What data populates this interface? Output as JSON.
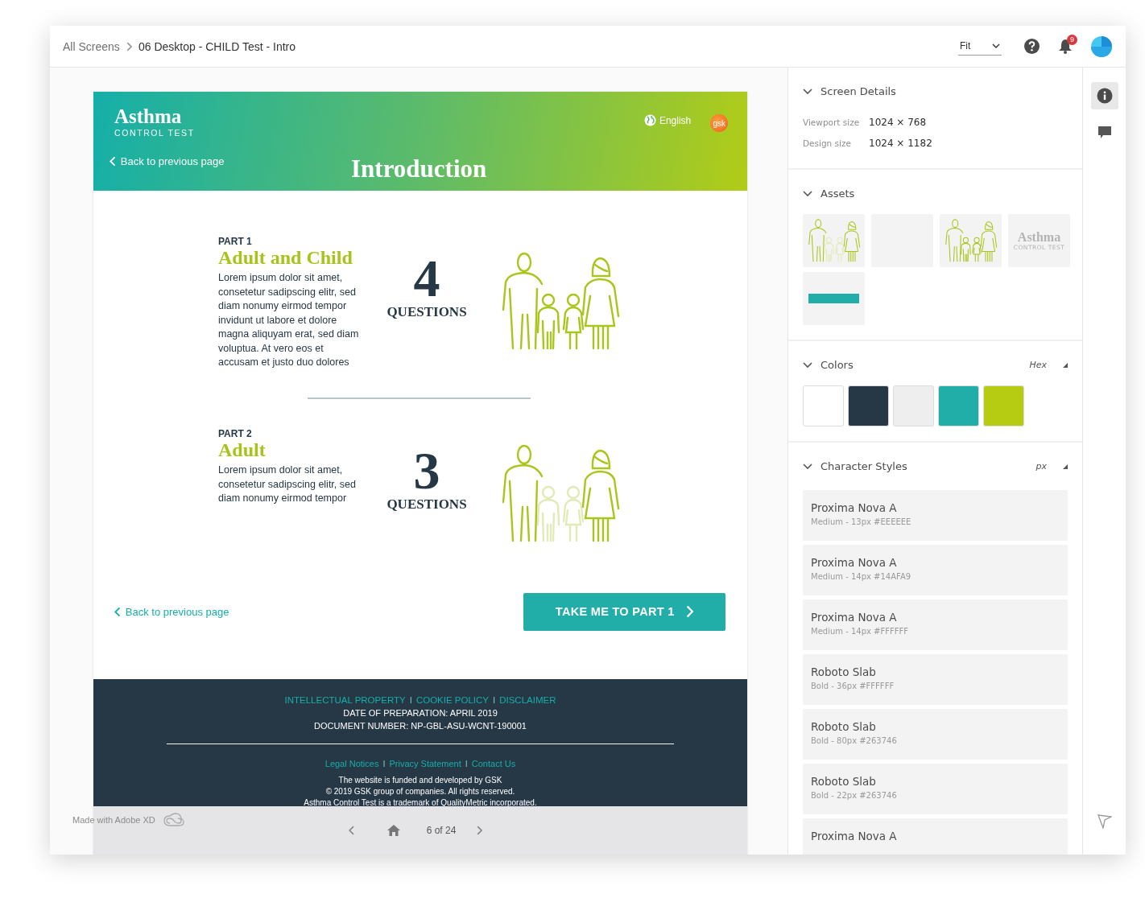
{
  "topbar": {
    "breadcrumb": [
      "All Screens",
      "06 Desktop - CHILD Test - Intro"
    ],
    "zoom": "Fit",
    "notifications": "9"
  },
  "artboard": {
    "logo": {
      "name": "Asthma",
      "tagline": "CONTROL TEST"
    },
    "language": "English",
    "brand": "gsk",
    "back_link": "Back to previous page",
    "title": "Introduction",
    "parts": [
      {
        "label": "PART 1",
        "title": "Adult and Child",
        "body": "Lorem ipsum dolor sit amet, consetetur sadipscing elitr, sed diam nonumy eirmod tempor invidunt ut labore et dolore magna aliquyam erat, sed diam voluptua. At vero eos et accusam et justo duo dolores",
        "count": "4",
        "count_label": "QUESTIONS",
        "children_faded": false
      },
      {
        "label": "PART 2",
        "title": "Adult",
        "body": "Lorem ipsum dolor sit amet, consetetur sadipscing elitr, sed diam nonumy eirmod tempor",
        "count": "3",
        "count_label": "QUESTIONS",
        "children_faded": true
      }
    ],
    "bottom_back_link": "Back to previous page",
    "cta": "TAKE ME TO PART 1",
    "footer": {
      "top_links": [
        {
          "kind": "link",
          "text": "INTELLECTUAL PROPERTY"
        },
        {
          "kind": "separator",
          "text": "I"
        },
        {
          "kind": "link",
          "text": "COOKIE POLICY"
        },
        {
          "kind": "separator",
          "text": "I"
        },
        {
          "kind": "link",
          "text": "DISCLAIMER"
        }
      ],
      "lines": [
        "DATE OF PREPARATION: APRIL 2019",
        "DOCUMENT NUMBER: NP-GBL-ASU-WCNT-190001"
      ],
      "bottom_links": [
        {
          "kind": "link",
          "text": "Legal Notices"
        },
        {
          "kind": "separator",
          "text": "I"
        },
        {
          "kind": "link",
          "text": "Privacy Statement"
        },
        {
          "kind": "separator",
          "text": "I"
        },
        {
          "kind": "link",
          "text": "Contact Us"
        }
      ],
      "notes": [
        "The website is funded and developed by GSK",
        "© 2019 GSK group of companies. All rights reserved.",
        "Asthma Control Test is a trademark of QualityMetric incorporated."
      ]
    }
  },
  "viewer": {
    "made_with": "Made with Adobe XD",
    "pager": "6 of 24"
  },
  "panel": {
    "screen_details": {
      "title": "Screen Details",
      "rows": [
        {
          "label": "Viewport size",
          "value": "1024 × 768"
        },
        {
          "label": "Design size",
          "value": "1024 × 1182"
        }
      ]
    },
    "assets": {
      "title": "Assets",
      "items": [
        {
          "kind": "family_faded"
        },
        {
          "kind": "blank"
        },
        {
          "kind": "family"
        },
        {
          "kind": "logo",
          "name": "Asthma",
          "tagline": "CONTROL TEST"
        },
        {
          "kind": "button"
        }
      ]
    },
    "colors": {
      "title": "Colors",
      "format": "Hex",
      "swatches": [
        {
          "color": "#ffffff"
        },
        {
          "color": "#263746"
        },
        {
          "color": "#eeeeee"
        },
        {
          "color": "#22aea8"
        },
        {
          "color": "#b5cc12"
        }
      ]
    },
    "character_styles": {
      "title": "Character Styles",
      "unit": "px",
      "items": [
        {
          "font": "Proxima Nova A",
          "detail": "Medium - 13px #EEEEEE"
        },
        {
          "font": "Proxima Nova A",
          "detail": "Medium - 14px #14AFA9"
        },
        {
          "font": "Proxima Nova A",
          "detail": "Medium - 14px #FFFFFF"
        },
        {
          "font": "Roboto Slab",
          "detail": "Bold - 36px #FFFFFF"
        },
        {
          "font": "Roboto Slab",
          "detail": "Bold - 80px #263746"
        },
        {
          "font": "Roboto Slab",
          "detail": "Bold - 22px #263746"
        },
        {
          "font": "Proxima Nova A"
        }
      ]
    }
  },
  "rail": [
    {
      "kind": "info",
      "selected": true
    },
    {
      "kind": "comment",
      "selected": false
    }
  ]
}
